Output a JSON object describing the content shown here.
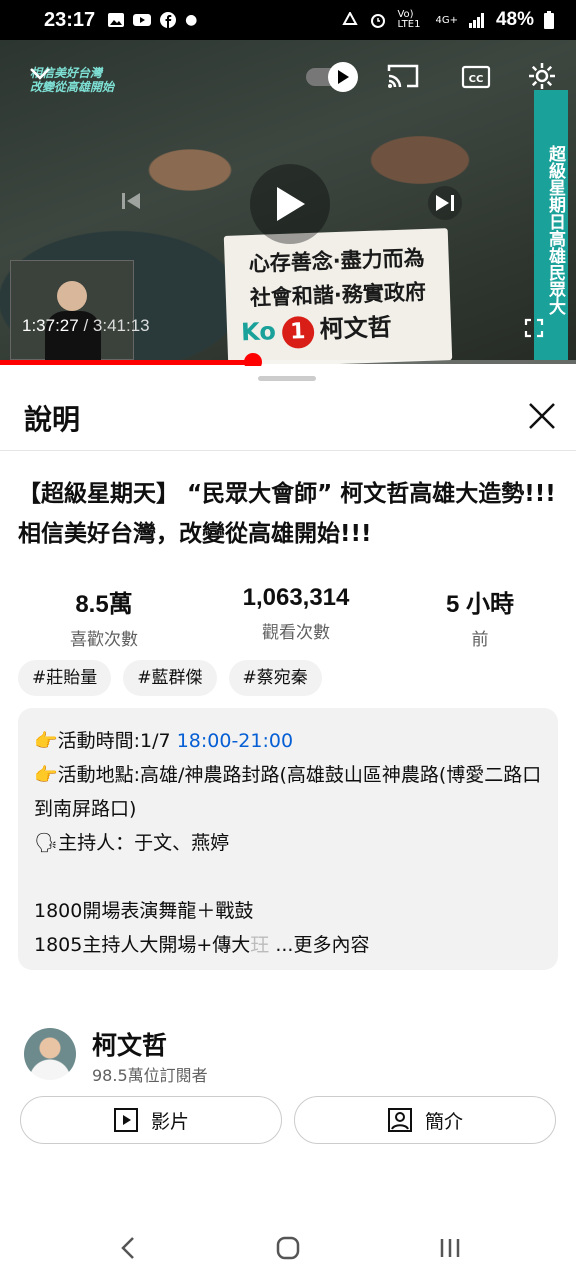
{
  "status_bar": {
    "time": "23:17",
    "battery": "48%",
    "network": "4G+",
    "carrier_tag": "Vo) LTE1"
  },
  "video": {
    "current_time": "1:37:27",
    "separator": " / ",
    "duration": "3:41:13",
    "progress_fraction": 0.44,
    "overlay_sign_line1": "心存善念·盡力而為",
    "overlay_sign_line2": "社會和諧·務實政府",
    "overlay_sign_ko": "Ko",
    "overlay_sign_number": "1",
    "overlay_sign_name": "柯文哲",
    "overlay_side_banner": "超級星期日高雄民眾大",
    "overlay_corner_logo_line1": "相信美好台灣",
    "overlay_corner_logo_line2": "改變從高雄開始"
  },
  "sheet": {
    "title": "說明",
    "video_title": "【超級星期天】 “民眾大會師” 柯文哲高雄大造勢!!!  相信美好台灣，改變從高雄開始!!!",
    "stats": {
      "likes_value": "8.5萬",
      "likes_label": "喜歡次數",
      "views_value": "1,063,314",
      "views_label": "觀看次數",
      "age_value": "5 小時",
      "age_label": "前"
    },
    "tags": [
      "#莊貽量",
      "#藍群傑",
      "#蔡宛秦"
    ],
    "description": {
      "line1_prefix": "👉活動時間:1/7 ",
      "line1_time": "18:00-21:00",
      "line2": "👉活動地點:高雄/神農路封路(高雄鼓山區神農路(博愛二路口到南屏路口)",
      "line3": "🗣主持人：于文、燕婷",
      "line4": "1800開場表演舞龍＋戰鼓",
      "line5": "1805主持人大開場+傳大",
      "line5_fade": "玨",
      "more": "...更多內容"
    },
    "channel": {
      "name": "柯文哲",
      "subscribers": "98.5萬位訂閱者"
    },
    "buttons": {
      "videos": "影片",
      "about": "簡介"
    }
  },
  "colors": {
    "progress_red": "#ff0000",
    "link_blue": "#065fd4",
    "chip_bg": "#f2f2f2"
  }
}
